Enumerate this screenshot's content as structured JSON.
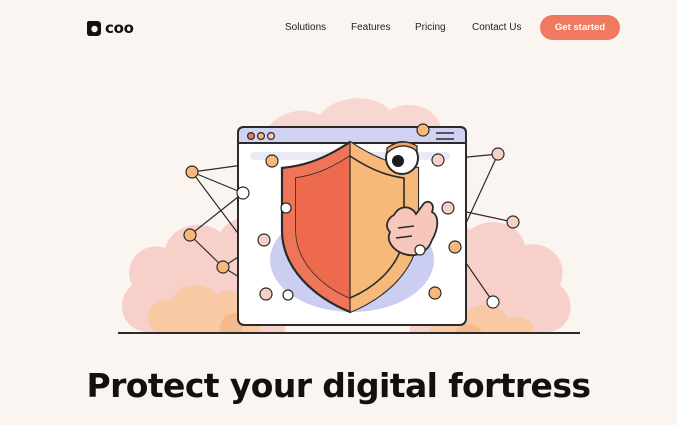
{
  "brand": {
    "name": "coo"
  },
  "nav": {
    "items": [
      {
        "label": "Solutions"
      },
      {
        "label": "Features"
      },
      {
        "label": "Pricing"
      },
      {
        "label": "Contact Us"
      }
    ],
    "cta_label": "Get started"
  },
  "hero": {
    "title": "Protect your digital fortress"
  },
  "colors": {
    "background": "#fbf5f2",
    "accent": "#ef7a5f",
    "shield_left": "#ef7458",
    "shield_right": "#f6b979",
    "cloud_pink": "#f7c9c3",
    "cloud_peach": "#f8c9a2",
    "network_node": "#f3d1c4",
    "window_frame": "#cfd2f2"
  },
  "icons": {
    "logo": "coo-logo-icon",
    "shield": "shield-icon",
    "eye": "eye-icon",
    "hand": "hand-icon"
  }
}
